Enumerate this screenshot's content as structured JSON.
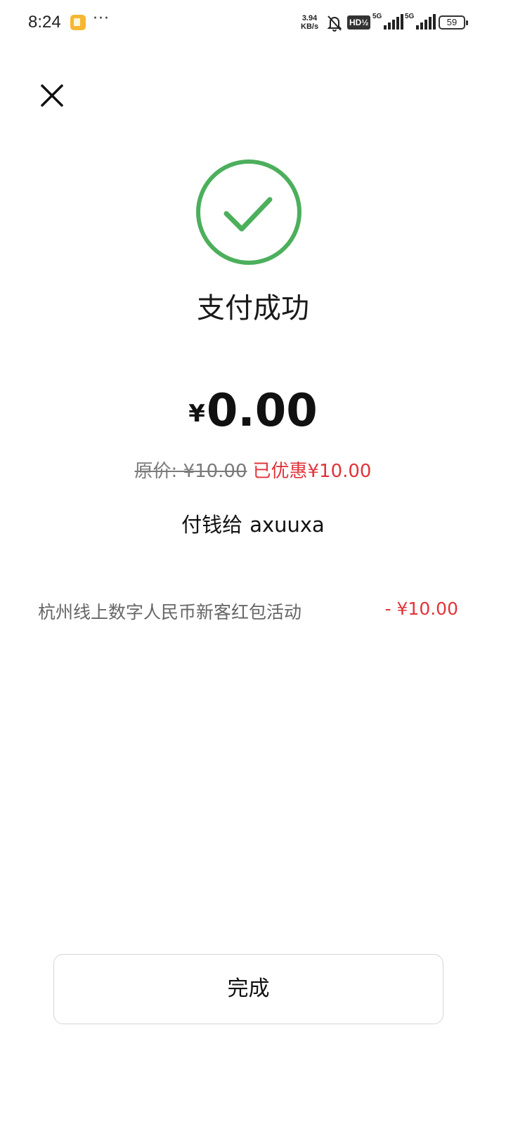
{
  "status_bar": {
    "time": "8:24",
    "dots": "···",
    "speed_value": "3.94",
    "speed_unit": "KB/s",
    "hd_label": "HD½",
    "network1": "5G",
    "network2": "5G",
    "battery": "59"
  },
  "result": {
    "title": "支付成功",
    "currency_symbol": "¥",
    "amount": "0.00",
    "original_price": "原价: ¥10.00",
    "discount_text": "已优惠¥10.00",
    "payee_label": "付钱给",
    "payee_name": "axuuxa"
  },
  "discounts": [
    {
      "label": "杭州线上数字人民币新客红包活动",
      "amount": "- ¥10.00"
    }
  ],
  "done_button": {
    "label": "完成"
  },
  "colors": {
    "success_green": "#4caf5c",
    "discount_red": "#e0343a",
    "text_primary": "#111111",
    "text_secondary": "#666666"
  },
  "icons": {
    "close": "close-icon",
    "success": "check-circle-icon",
    "mute": "bell-off-icon"
  }
}
